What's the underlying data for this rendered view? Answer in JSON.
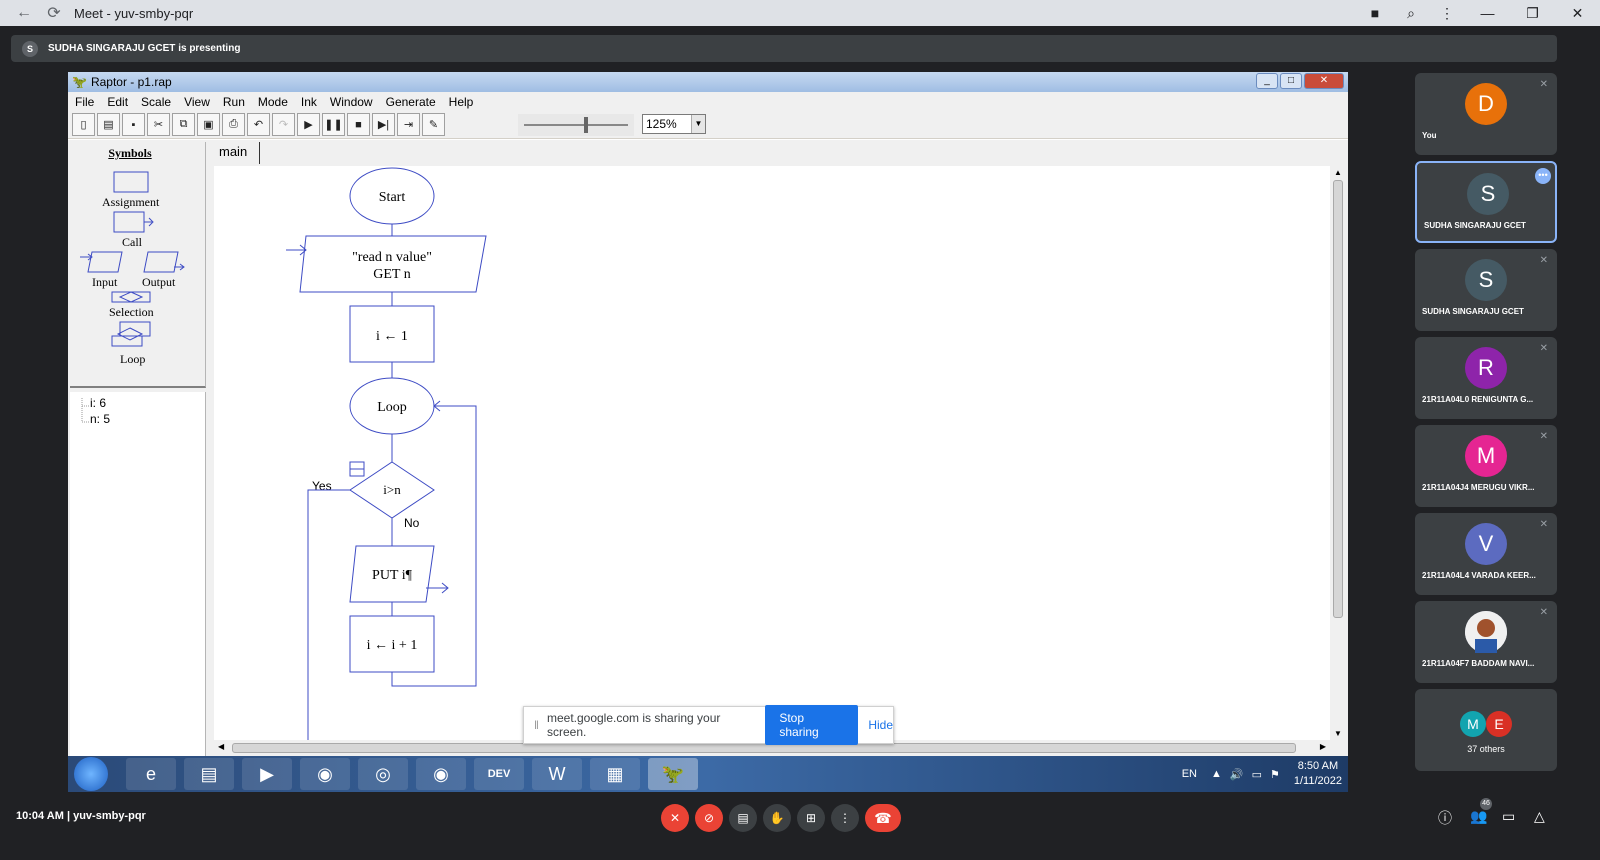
{
  "browser": {
    "title": "Meet - yuv-smby-pqr"
  },
  "presenting_bar": {
    "avatar": "S",
    "text": "SUDHA SINGARAJU GCET is presenting"
  },
  "raptor": {
    "title": "Raptor - p1.rap",
    "menu": [
      "File",
      "Edit",
      "Scale",
      "View",
      "Run",
      "Mode",
      "Ink",
      "Window",
      "Generate",
      "Help"
    ],
    "zoom": "125%",
    "symbols_header": "Symbols",
    "symbols": {
      "assignment": "Assignment",
      "call": "Call",
      "input": "Input",
      "output": "Output",
      "selection": "Selection",
      "loop": "Loop"
    },
    "variables": [
      "i: 6",
      "n: 5"
    ],
    "tab": "main",
    "flowchart": {
      "start": "Start",
      "input_line1": "\"read n value\"",
      "input_line2": "GET n",
      "assign1": "i ← 1",
      "loop": "Loop",
      "condition": "i>n",
      "yes": "Yes",
      "no": "No",
      "output": "PUT i¶",
      "assign2": "i ← i + 1"
    }
  },
  "share_banner": {
    "message": "meet.google.com is sharing your screen.",
    "stop": "Stop sharing",
    "hide": "Hide"
  },
  "taskbar": {
    "lang": "EN",
    "time": "8:50 AM",
    "date": "1/11/2022",
    "dev_label": "DEV"
  },
  "participants": [
    {
      "initial": "D",
      "name": "You",
      "color": "#e8710a"
    },
    {
      "initial": "S",
      "name": "SUDHA SINGARAJU GCET",
      "color": "#455a64"
    },
    {
      "initial": "S",
      "name": "SUDHA SINGARAJU GCET",
      "color": "#455a64"
    },
    {
      "initial": "R",
      "name": "21R11A04L0 RENIGUNTA G...",
      "color": "#8e24aa"
    },
    {
      "initial": "M",
      "name": "21R11A04J4 MERUGU VIKR...",
      "color": "#e52592"
    },
    {
      "initial": "V",
      "name": "21R11A04L4 VARADA KEER...",
      "color": "#5c6bc0"
    },
    {
      "initial": "",
      "name": "21R11A04F7 BADDAM NAVI...",
      "color": "#c5cae9"
    }
  ],
  "others_tile": {
    "m": "M",
    "e": "E",
    "label": "37 others"
  },
  "footer": {
    "meeting_info": "10:04 AM  |  yuv-smby-pqr",
    "participant_count": "46"
  }
}
